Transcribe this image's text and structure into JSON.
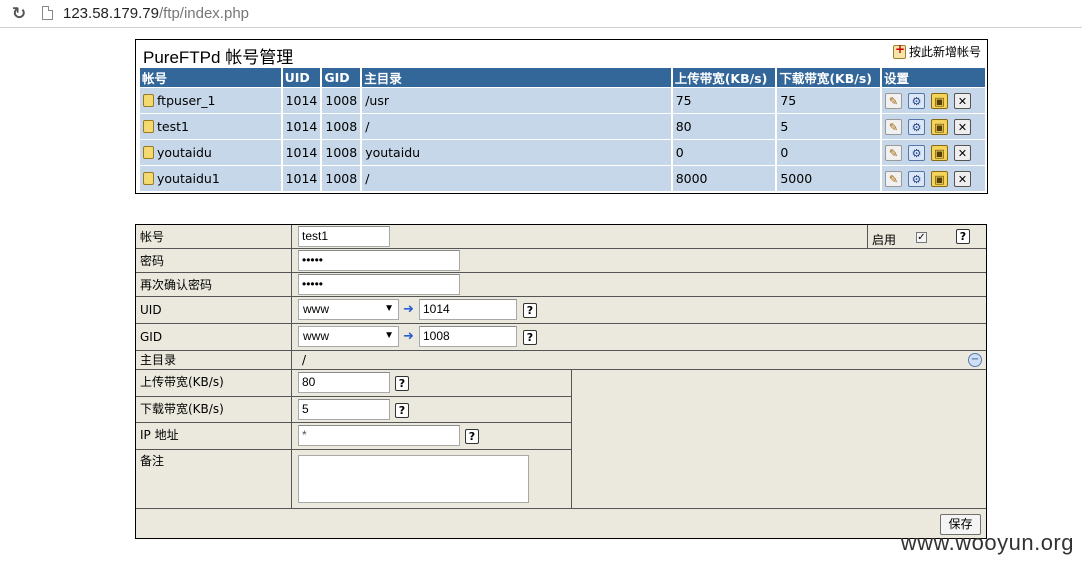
{
  "browser": {
    "url_host": "123.58.179.79",
    "url_path": "/ftp/index.php"
  },
  "panel": {
    "title": "PureFTPd 帐号管理",
    "add_link": "按此新增帐号"
  },
  "table": {
    "headers": [
      "帐号",
      "UID",
      "GID",
      "主目录",
      "上传带宽(KB/s)",
      "下载带宽(KB/s)",
      "设置"
    ],
    "rows": [
      {
        "account": "ftpuser_1",
        "uid": "1014",
        "gid": "1008",
        "home": "/usr",
        "upload": "75",
        "download": "75"
      },
      {
        "account": "test1",
        "uid": "1014",
        "gid": "1008",
        "home": "/",
        "upload": "80",
        "download": "5"
      },
      {
        "account": "youtaidu",
        "uid": "1014",
        "gid": "1008",
        "home": "youtaidu",
        "upload": "0",
        "download": "0"
      },
      {
        "account": "youtaidu1",
        "uid": "1014",
        "gid": "1008",
        "home": "/",
        "upload": "8000",
        "download": "5000"
      }
    ]
  },
  "form": {
    "account_label": "帐号",
    "account_value": "test1",
    "enable_label": "启用",
    "enabled": true,
    "password_label": "密码",
    "password_value": "•••••",
    "confirm_label": "再次确认密码",
    "confirm_value": "•••••",
    "uid_label": "UID",
    "uid_select": "www",
    "uid_value": "1014",
    "gid_label": "GID",
    "gid_select": "www",
    "gid_value": "1008",
    "home_label": "主目录",
    "home_value": "/",
    "upload_label": "上传带宽(KB/s)",
    "upload_value": "80",
    "download_label": "下载带宽(KB/s)",
    "download_value": "5",
    "ip_label": "IP 地址",
    "ip_value": "*",
    "note_label": "备注",
    "note_value": "",
    "save_label": "保存"
  },
  "watermark": "www.wooyun.org",
  "icons": {
    "reload": "reload-icon",
    "help": "help-icon",
    "arrow": "arrow-right-icon",
    "collapse": "collapse-icon"
  }
}
